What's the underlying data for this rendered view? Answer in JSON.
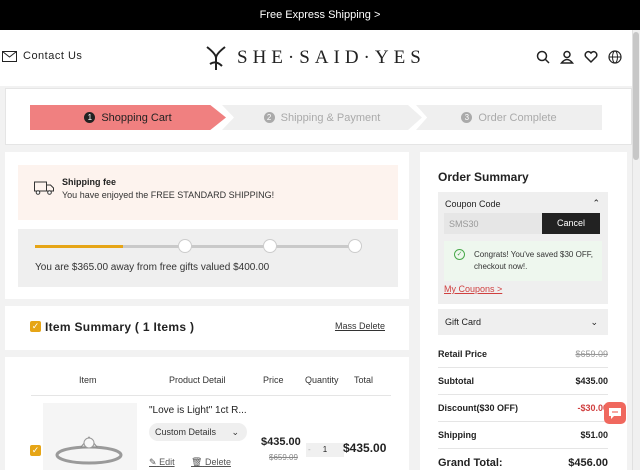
{
  "topbar": {
    "text": "Free Express Shipping >"
  },
  "header": {
    "contact_label": "Contact Us",
    "logo_text": "SHE·SAID·YES",
    "icons": [
      "search-icon",
      "user-icon",
      "heart-icon",
      "globe-icon"
    ]
  },
  "steps": [
    {
      "num": "1",
      "label": "Shopping Cart",
      "active": true
    },
    {
      "num": "2",
      "label": "Shipping & Payment",
      "active": false
    },
    {
      "num": "3",
      "label": "Order Complete",
      "active": false
    }
  ],
  "shipping": {
    "title": "Shipping fee",
    "desc": "You have enjoyed the FREE STANDARD SHIPPING!"
  },
  "progress": {
    "fraction": 0.27,
    "text": "You are $365.00 away from free gifts valued $400.00"
  },
  "items": {
    "summary_title": "Item Summary ( 1 Items )",
    "mass_delete": "Mass Delete",
    "headers": [
      "Item",
      "Product Detail",
      "Price",
      "Quantity",
      "Total"
    ],
    "product": {
      "name": "\"Love is Light\" 1ct R...",
      "custom_label": "Custom Details",
      "edit_label": "Edit",
      "delete_label": "Delete",
      "price": "$435.00",
      "old_price": "$659.09",
      "qty_minus": "-",
      "quantity": "1",
      "total": "$435.00"
    }
  },
  "summary": {
    "title": "Order Summary",
    "coupon_label": "Coupon Code",
    "coupon_value": "SMS30",
    "cancel_label": "Cancel",
    "congrats": "Congrats! You've saved $30 OFF, checkout now!.",
    "my_coupons": "My Coupons >",
    "gift_card": "Gift Card",
    "rows": [
      {
        "label": "Retail Price",
        "value": "$659.09"
      },
      {
        "label": "Subtotal",
        "value": "$435.00"
      },
      {
        "label": "Discount($30 OFF)",
        "value": "-$30.00"
      },
      {
        "label": "Shipping",
        "value": "$51.00"
      },
      {
        "label": "Grand Total:",
        "value": "$456.00"
      }
    ]
  },
  "colors": {
    "accent": "#f08080",
    "gold": "#e6a516",
    "discount": "#d04040"
  }
}
